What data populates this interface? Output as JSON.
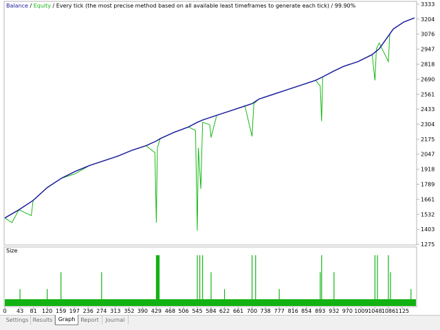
{
  "header": {
    "balance_label": "Balance",
    "separator": " / ",
    "equity_label": "Equity",
    "description": " / Every tick (the most precise method based on all available least timeframes to generate each tick) / 99.90%"
  },
  "colors": {
    "balance": "#1c1c9c",
    "equity": "#14b814",
    "volume": "#12b212",
    "frame": "#b4b4b4",
    "text": "#000000"
  },
  "size_panel": {
    "label": "Size"
  },
  "tabs": [
    {
      "label": "Settings",
      "active": false
    },
    {
      "label": "Results",
      "active": false
    },
    {
      "label": "Graph",
      "active": true
    },
    {
      "label": "Report",
      "active": false
    },
    {
      "label": "Journal",
      "active": false
    }
  ],
  "chart_data": {
    "type": "line",
    "title": "",
    "xlabel": "",
    "ylabel": "",
    "ylim": [
      1275,
      3333
    ],
    "y_ticks": [
      1275,
      1403,
      1532,
      1661,
      1789,
      1918,
      2047,
      2175,
      2304,
      2433,
      2561,
      2690,
      2818,
      2947,
      3076,
      3204,
      3333
    ],
    "x_ticks": [
      0,
      43,
      81,
      120,
      159,
      197,
      236,
      274,
      313,
      352,
      390,
      429,
      468,
      506,
      545,
      584,
      622,
      661,
      700,
      738,
      777,
      816,
      854,
      893,
      932,
      970,
      1009,
      1048,
      1086,
      1125
    ],
    "xlim": [
      0,
      1164
    ],
    "legend": "none",
    "grid": false,
    "series": [
      {
        "name": "Balance",
        "x": [
          0,
          40,
          80,
          120,
          160,
          200,
          240,
          280,
          320,
          360,
          400,
          429,
          440,
          480,
          520,
          545,
          560,
          600,
          640,
          680,
          700,
          720,
          760,
          800,
          840,
          880,
          900,
          932,
          960,
          1000,
          1040,
          1060,
          1086,
          1100,
          1130,
          1160
        ],
        "values": [
          1500,
          1570,
          1650,
          1760,
          1840,
          1900,
          1950,
          1990,
          2030,
          2080,
          2120,
          2160,
          2180,
          2235,
          2280,
          2320,
          2340,
          2380,
          2420,
          2460,
          2480,
          2520,
          2560,
          2600,
          2640,
          2680,
          2710,
          2760,
          2800,
          2840,
          2900,
          2950,
          3060,
          3120,
          3180,
          3215
        ]
      },
      {
        "name": "Equity",
        "x": [
          0,
          20,
          40,
          75,
          80,
          120,
          160,
          200,
          240,
          280,
          320,
          360,
          400,
          425,
          429,
          432,
          440,
          480,
          520,
          540,
          545,
          548,
          555,
          560,
          580,
          584,
          600,
          640,
          680,
          700,
          705,
          720,
          760,
          800,
          840,
          880,
          893,
          897,
          900,
          932,
          960,
          1000,
          1040,
          1048,
          1052,
          1060,
          1086,
          1090,
          1100,
          1130,
          1160
        ],
        "values": [
          1500,
          1460,
          1570,
          1520,
          1650,
          1760,
          1840,
          1880,
          1950,
          1990,
          2030,
          2080,
          2120,
          2060,
          1460,
          2100,
          2180,
          2235,
          2280,
          2250,
          1390,
          2100,
          1750,
          2320,
          2300,
          2190,
          2380,
          2420,
          2460,
          2200,
          2480,
          2520,
          2560,
          2600,
          2640,
          2680,
          2630,
          2330,
          2710,
          2760,
          2800,
          2840,
          2900,
          2680,
          2950,
          3000,
          2840,
          3080,
          3120,
          3180,
          3215
        ]
      }
    ],
    "size_series": {
      "x": [
        43,
        120,
        159,
        274,
        429,
        431,
        433,
        435,
        437,
        545,
        552,
        560,
        584,
        622,
        700,
        710,
        777,
        893,
        897,
        932,
        1048,
        1055,
        1086,
        1092,
        1150
      ],
      "values": [
        1,
        1,
        2,
        2,
        3,
        3,
        3,
        3,
        3,
        3,
        3,
        3,
        2,
        1,
        3,
        3,
        1,
        2,
        3,
        2,
        3,
        3,
        3,
        2,
        1
      ],
      "baseline": 0.4,
      "max": 3
    }
  }
}
